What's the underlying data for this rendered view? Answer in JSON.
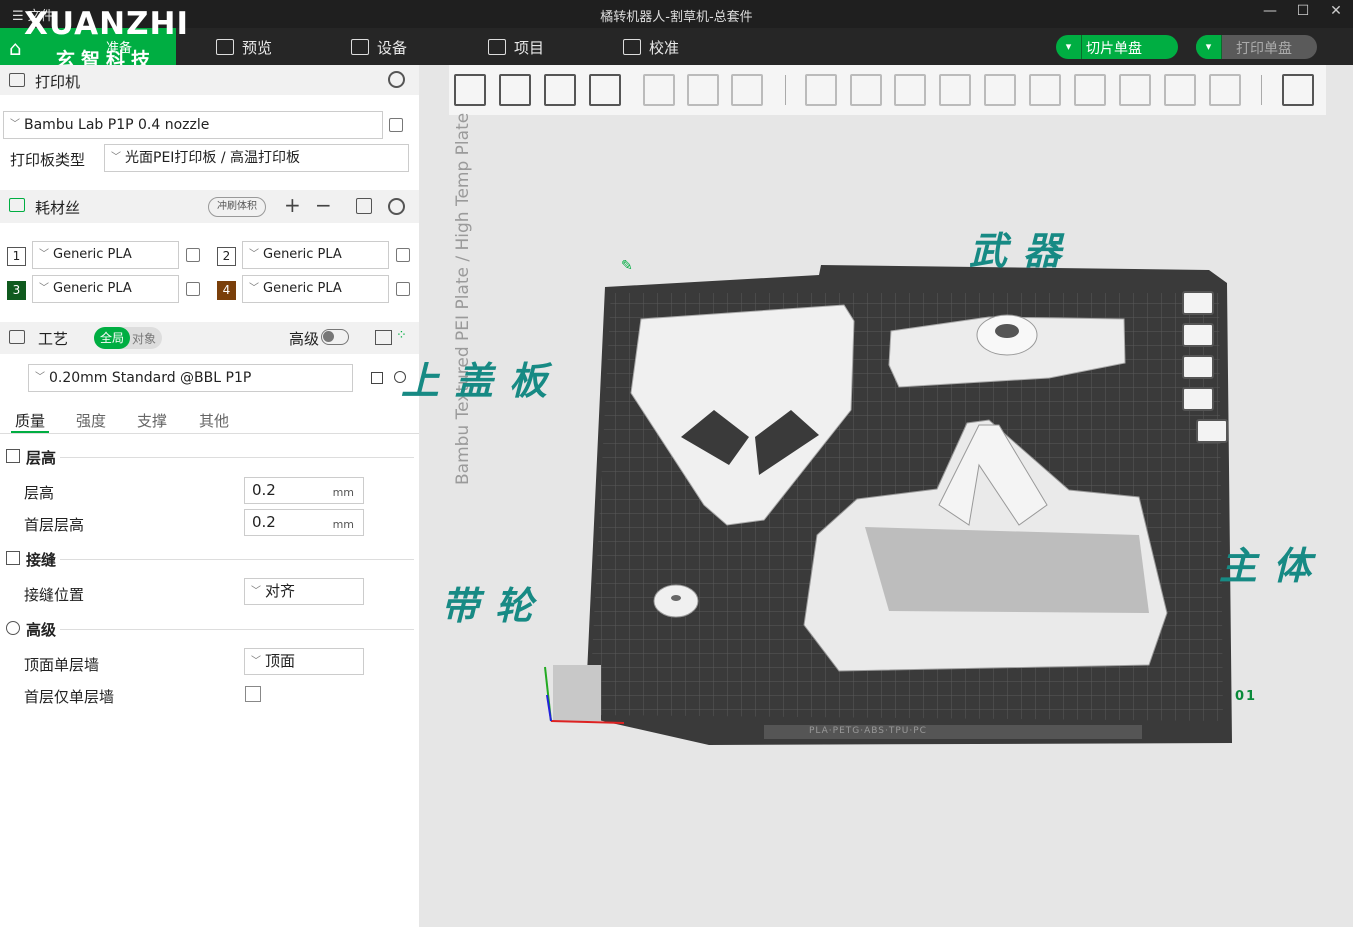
{
  "titlebar": {
    "menu_label": "文件",
    "title": "橘转机器人-割草机-总套件",
    "minimize": "—",
    "maximize": "☐",
    "close": "✕"
  },
  "logo": {
    "text": "XUANZHI",
    "subtitle": "玄智科技",
    "home_tab_label": "准备"
  },
  "nav": {
    "tabs": [
      {
        "label": "预览",
        "icon": "layers-icon"
      },
      {
        "label": "设备",
        "icon": "device-icon"
      },
      {
        "label": "项目",
        "icon": "project-icon"
      },
      {
        "label": "校准",
        "icon": "calibration-icon"
      }
    ],
    "slice_button": "切片单盘",
    "print_button": "打印单盘",
    "accent_color": "#00ae42"
  },
  "printer": {
    "section_title": "打印机",
    "printer_name": "Bambu Lab P1P 0.4 nozzle",
    "plate_type_label": "打印板类型",
    "plate_type_value": "光面PEI打印板 / 高温打印板"
  },
  "filament": {
    "section_title": "耗材丝",
    "flush_button": "冲刷体积",
    "add": "+",
    "remove": "−",
    "slots": [
      {
        "num": "1",
        "name": "Generic PLA",
        "color": "#ffffff"
      },
      {
        "num": "2",
        "name": "Generic PLA",
        "color": "#ffffff"
      },
      {
        "num": "3",
        "name": "Generic PLA",
        "color": "#0f5a1e"
      },
      {
        "num": "4",
        "name": "Generic PLA",
        "color": "#7a3f0a"
      }
    ]
  },
  "process": {
    "section_title": "工艺",
    "toggle_global": "全局",
    "toggle_object": "对象",
    "advanced_label": "高级",
    "preset": "0.20mm Standard @BBL P1P",
    "tabs": [
      "质量",
      "强度",
      "支撑",
      "其他"
    ],
    "groups": {
      "layer_height": {
        "title": "层高",
        "rows": [
          {
            "label": "层高",
            "value": "0.2",
            "unit": "mm"
          },
          {
            "label": "首层层高",
            "value": "0.2",
            "unit": "mm"
          }
        ]
      },
      "seam": {
        "title": "接缝",
        "rows": [
          {
            "label": "接缝位置",
            "value": "对齐"
          }
        ]
      },
      "advanced": {
        "title": "高级",
        "rows": [
          {
            "label": "顶面单层墙",
            "value": "顶面"
          },
          {
            "label": "首层仅单层墙",
            "value": ""
          }
        ]
      }
    }
  },
  "viewport": {
    "plate_text": "Bambu Textured PEI Plate / High Temp Plate",
    "plate_footer": "PLA·PETG·ABS·TPU·PC",
    "plate_number": "01",
    "annotations": {
      "weapon": "武器",
      "top_cover": "上盖板",
      "body": "主体",
      "pulley": "带轮"
    }
  }
}
